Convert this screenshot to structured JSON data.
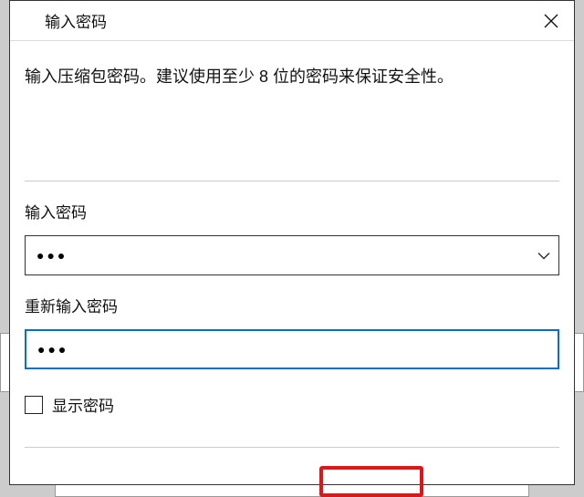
{
  "dialog": {
    "title": "输入密码",
    "instruction": "输入压缩包密码。建议使用至少 8 位的密码来保证安全性。"
  },
  "fields": {
    "password_label": "输入密码",
    "password_value": "●●●",
    "confirm_label": "重新输入密码",
    "confirm_value": "●●●"
  },
  "options": {
    "show_password_label": "显示密码",
    "show_password_checked": false
  },
  "icons": {
    "close": "close-icon",
    "chevron": "chevron-down-icon"
  }
}
